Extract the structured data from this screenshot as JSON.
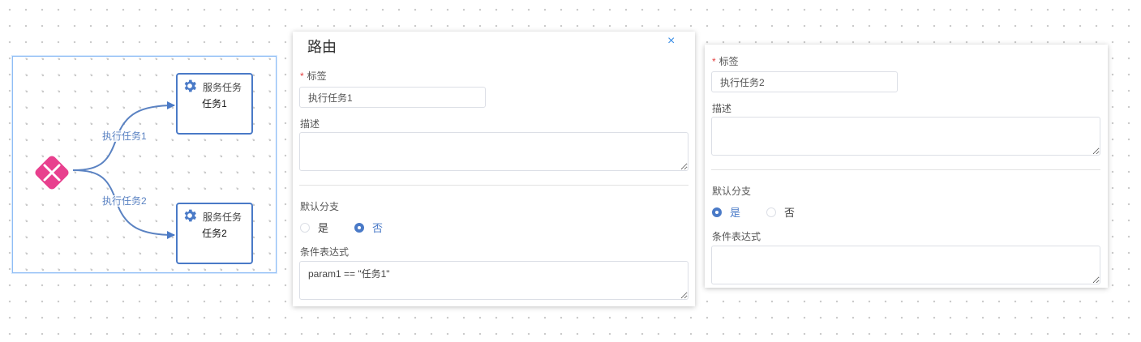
{
  "diagram": {
    "tasks": [
      {
        "type": "服务任务",
        "name": "任务1"
      },
      {
        "type": "服务任务",
        "name": "任务2"
      }
    ],
    "edges": [
      {
        "label": "执行任务1"
      },
      {
        "label": "执行任务2"
      }
    ],
    "colors": {
      "task_border": "#4a7ac7",
      "gateway": "#e8408e",
      "edge": "#5a82c2"
    }
  },
  "panel1": {
    "title": "路由",
    "close_icon": "×",
    "label_field": {
      "label": "标签",
      "required_mark": "*",
      "value": "执行任务1"
    },
    "description_field": {
      "label": "描述",
      "value": ""
    },
    "default_branch": {
      "label": "默认分支",
      "options": [
        {
          "label": "是",
          "checked": false
        },
        {
          "label": "否",
          "checked": true
        }
      ]
    },
    "condition_field": {
      "label": "条件表达式",
      "value": "param1 == \"任务1\""
    }
  },
  "panel2": {
    "label_field": {
      "label": "标签",
      "required_mark": "*",
      "value": "执行任务2"
    },
    "description_field": {
      "label": "描述",
      "value": ""
    },
    "default_branch": {
      "label": "默认分支",
      "options": [
        {
          "label": "是",
          "checked": true
        },
        {
          "label": "否",
          "checked": false
        }
      ]
    },
    "condition_field": {
      "label": "条件表达式",
      "value": ""
    }
  }
}
